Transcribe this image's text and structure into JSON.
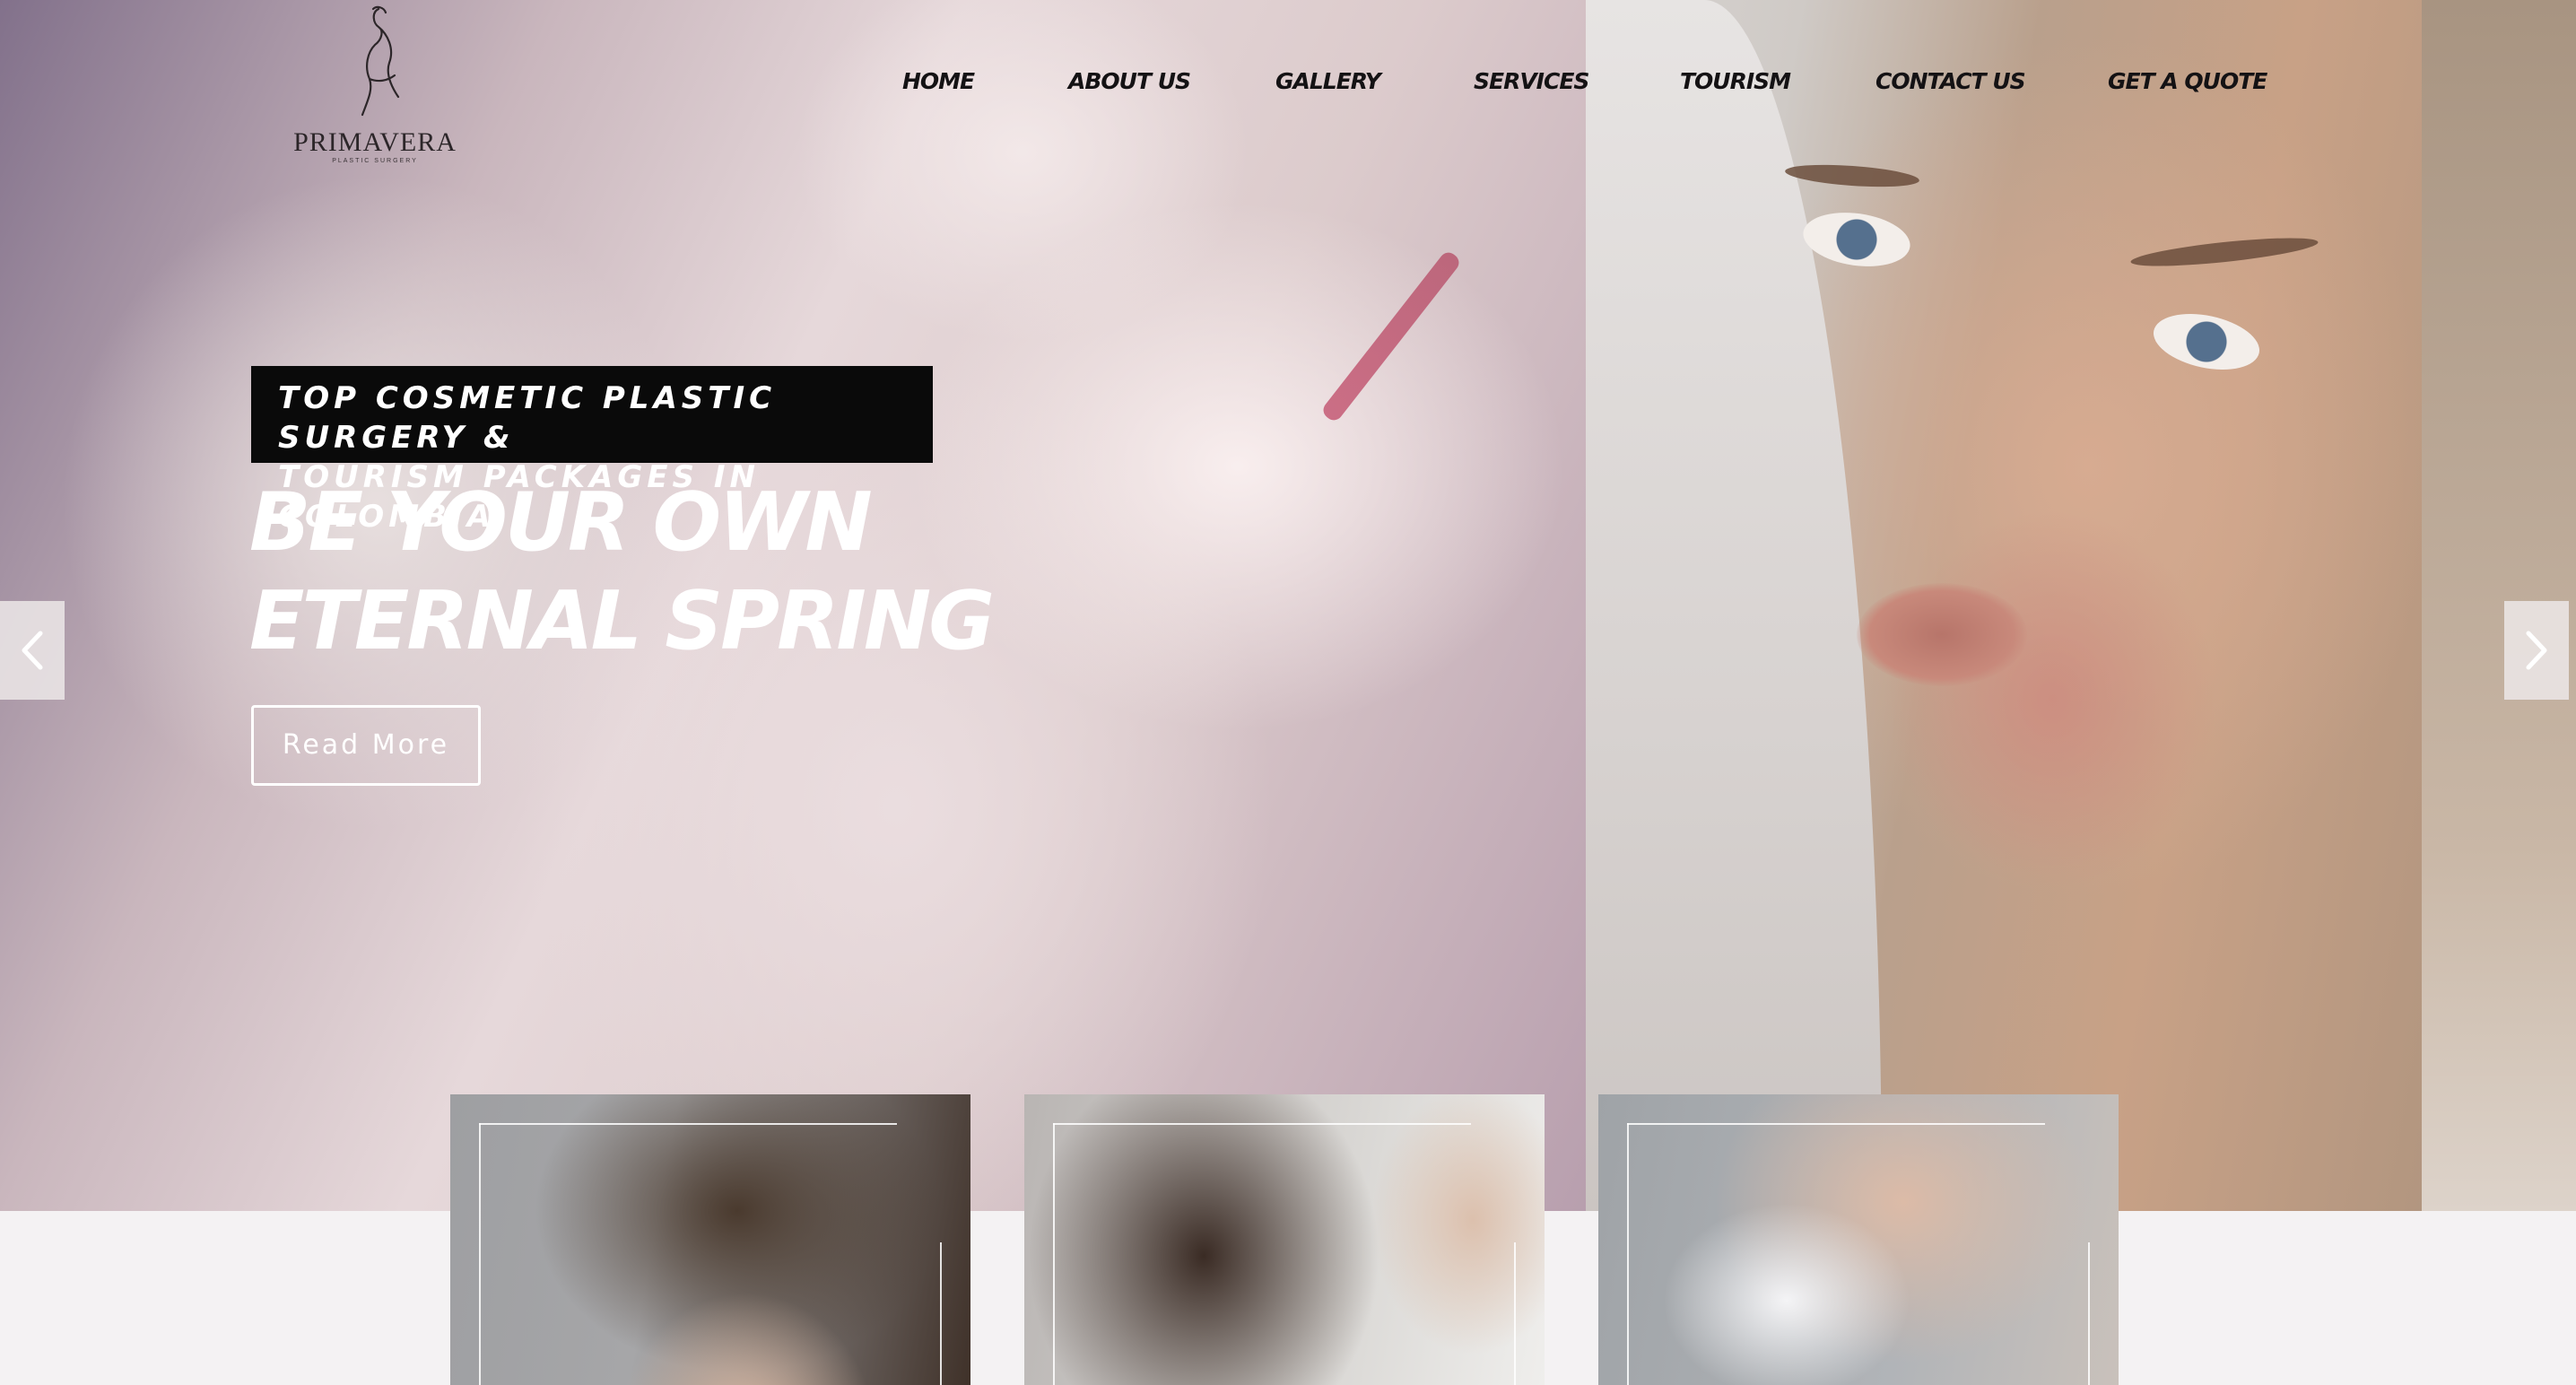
{
  "logo": {
    "name": "PRIMAVERA",
    "tagline": "PLASTIC SURGERY"
  },
  "nav": {
    "items": [
      {
        "label": "HOME"
      },
      {
        "label": "ABOUT US"
      },
      {
        "label": "GALLERY"
      },
      {
        "label": "SERVICES"
      },
      {
        "label": "TOURISM"
      },
      {
        "label": "CONTACT US"
      },
      {
        "label": "GET A QUOTE"
      }
    ]
  },
  "hero": {
    "tagline": "TOP COSMETIC PLASTIC SURGERY &\nTOURISM PACKAGES IN COLOMBIA",
    "headline": "BE YOUR OWN ETERNAL SPRING",
    "cta_label": "Read More"
  },
  "slider": {
    "prev_icon": "chevron-left-icon",
    "next_icon": "chevron-right-icon"
  },
  "colors": {
    "tagline_bg": "#0a0a0a",
    "hero_text": "#ffffff",
    "page_bg": "#f4f2f3"
  }
}
